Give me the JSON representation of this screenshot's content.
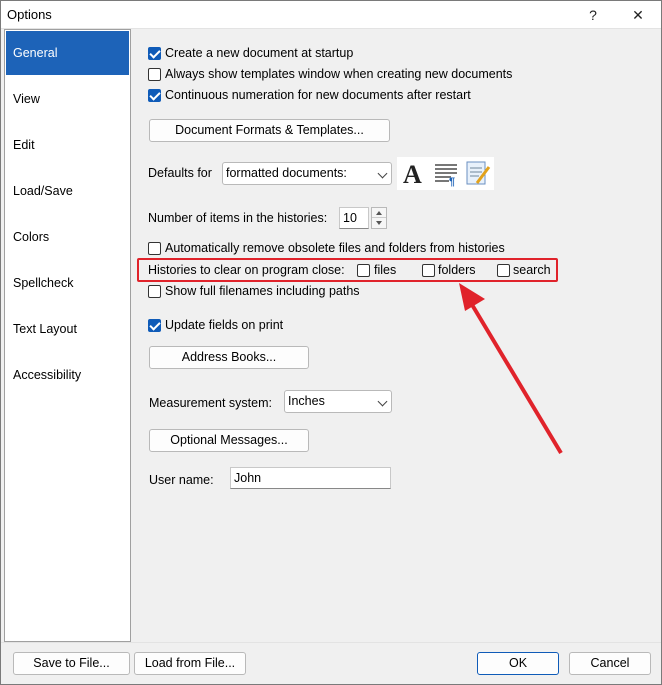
{
  "window": {
    "title": "Options",
    "help_glyph": "?",
    "close_glyph": "✕"
  },
  "sidebar": {
    "items": [
      {
        "label": "General",
        "selected": true
      },
      {
        "label": "View",
        "selected": false
      },
      {
        "label": "Edit",
        "selected": false
      },
      {
        "label": "Load/Save",
        "selected": false
      },
      {
        "label": "Colors",
        "selected": false
      },
      {
        "label": "Spellcheck",
        "selected": false
      },
      {
        "label": "Text Layout",
        "selected": false
      },
      {
        "label": "Accessibility",
        "selected": false
      }
    ]
  },
  "general": {
    "create_new_doc": {
      "label": "Create a new document at startup",
      "checked": true
    },
    "always_show_templates": {
      "label": "Always show templates window when creating new documents",
      "checked": false
    },
    "continuous_numeration": {
      "label": "Continuous numeration for new documents after restart",
      "checked": true
    },
    "document_formats_button": "Document Formats & Templates...",
    "defaults_for_label": "Defaults for",
    "defaults_for_value": "formatted documents:",
    "history_items_label": "Number of items in the histories:",
    "history_items_value": "10",
    "auto_remove_obsolete": {
      "label": "Automatically remove obsolete files and folders from histories",
      "checked": false
    },
    "histories_clear_label": "Histories to clear on program close:",
    "clear_files": {
      "label": "files",
      "checked": false
    },
    "clear_folders": {
      "label": "folders",
      "checked": false
    },
    "clear_search": {
      "label": "search",
      "checked": false
    },
    "show_full_filenames": {
      "label": "Show full filenames including paths",
      "checked": false
    },
    "update_fields_on_print": {
      "label": "Update fields on print",
      "checked": true
    },
    "address_books_button": "Address Books...",
    "measurement_label": "Measurement system:",
    "measurement_value": "Inches",
    "optional_messages_button": "Optional Messages...",
    "user_name_label": "User name:",
    "user_name_value": "John"
  },
  "footer": {
    "save_to_file": "Save to File...",
    "load_from_file": "Load from File...",
    "ok": "OK",
    "cancel": "Cancel"
  },
  "colors": {
    "accent": "#1d63b8",
    "checkbox_checked": "#0f5bb8",
    "annotation_red": "#e0232b"
  }
}
